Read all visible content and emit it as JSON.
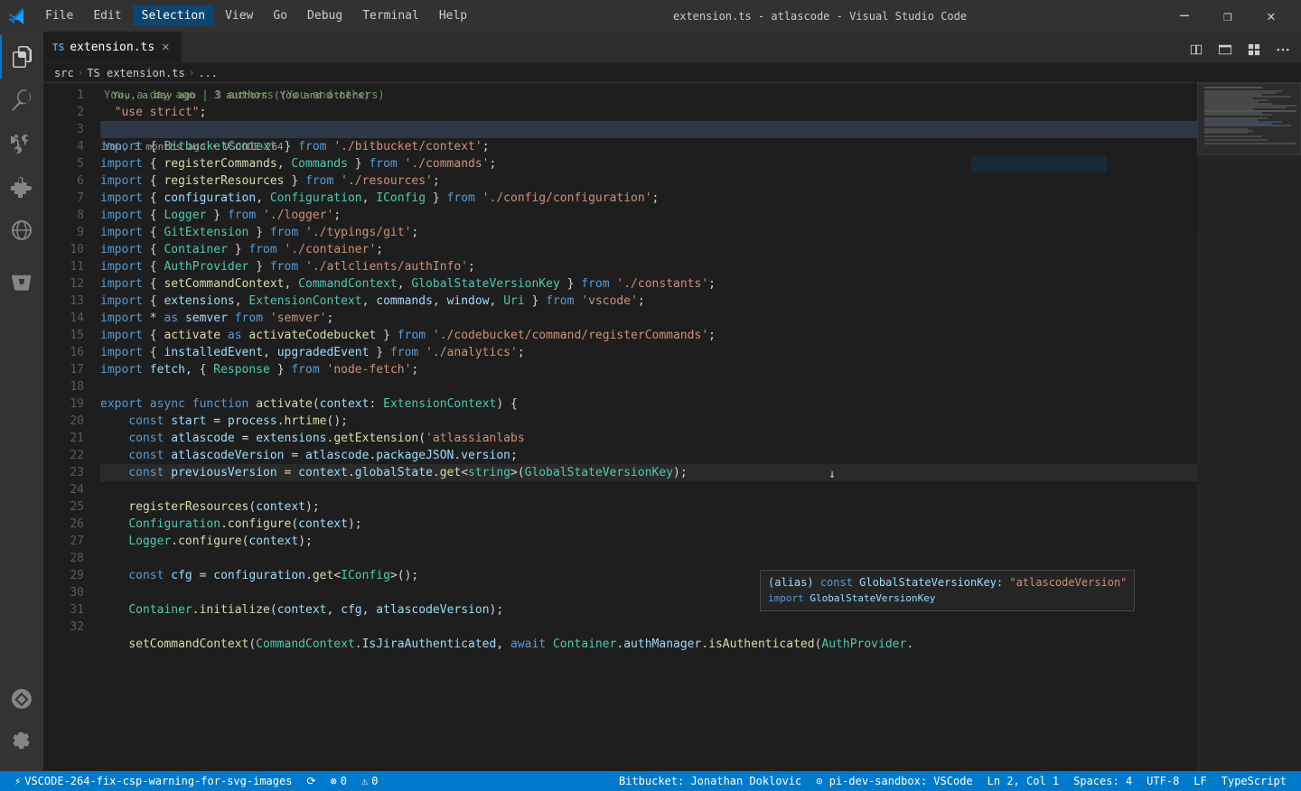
{
  "titleBar": {
    "logo": "VS",
    "menu": [
      "File",
      "Edit",
      "Selection",
      "View",
      "Go",
      "Debug",
      "Terminal",
      "Help"
    ],
    "activeMenu": "Selection",
    "title": "extension.ts - atlascode - Visual Studio Code",
    "buttons": [
      "─",
      "❐",
      "✕"
    ]
  },
  "tabs": [
    {
      "label": "extension.ts",
      "type": "ts",
      "active": true,
      "dirty": false
    }
  ],
  "breadcrumb": [
    "src",
    "TS extension.ts",
    "..."
  ],
  "blameTooltip": "You, a day ago | 3 authors (You and others)",
  "hoverPopup": {
    "line1_alias": "(alias) const GlobalStateVersionKey: \"atlascodeVersion\"",
    "line2_import": "import GlobalStateVersionKey"
  },
  "lines": [
    {
      "num": 1,
      "code": "  \"use strict\";"
    },
    {
      "num": 2,
      "code": ""
    },
    {
      "num": 3,
      "code": "import { BitbucketContext } from './bitbucket/context';"
    },
    {
      "num": 4,
      "code": "import { registerCommands, Commands } from './commands';"
    },
    {
      "num": 5,
      "code": "import { registerResources } from './resources';"
    },
    {
      "num": 6,
      "code": "import { configuration, Configuration, IConfig } from './config/configuration';"
    },
    {
      "num": 7,
      "code": "import { Logger } from './logger';"
    },
    {
      "num": 8,
      "code": "import { GitExtension } from './typings/git';"
    },
    {
      "num": 9,
      "code": "import { Container } from './container';"
    },
    {
      "num": 10,
      "code": "import { AuthProvider } from './atlclients/authInfo';"
    },
    {
      "num": 11,
      "code": "import { setCommandContext, CommandContext, GlobalStateVersionKey } from './constants';"
    },
    {
      "num": 12,
      "code": "import { extensions, ExtensionContext, commands, window, Uri } from 'vscode';"
    },
    {
      "num": 13,
      "code": "import * as semver from 'semver';"
    },
    {
      "num": 14,
      "code": "import { activate as activateCodebucket } from './codebucket/command/registerCommands';"
    },
    {
      "num": 15,
      "code": "import { installedEvent, upgradedEvent } from './analytics';"
    },
    {
      "num": 16,
      "code": "import fetch, { Response } from 'node-fetch';"
    },
    {
      "num": 17,
      "code": ""
    },
    {
      "num": 18,
      "code": "export async function activate(context: ExtensionContext) {"
    },
    {
      "num": 19,
      "code": "    const start = process.hrtime();"
    },
    {
      "num": 20,
      "code": "    const atlascode = extensions.getExtension('atlassianlabs"
    },
    {
      "num": 21,
      "code": "    const atlascodeVersion = atlascode.packageJSON.version;"
    },
    {
      "num": 22,
      "code": "    const previousVersion = context.globalState.get<string>(GlobalStateVersionKey);"
    },
    {
      "num": 23,
      "code": ""
    },
    {
      "num": 24,
      "code": "    registerResources(context);"
    },
    {
      "num": 25,
      "code": "    Configuration.configure(context);"
    },
    {
      "num": 26,
      "code": "    Logger.configure(context);"
    },
    {
      "num": 27,
      "code": ""
    },
    {
      "num": 28,
      "code": "    const cfg = configuration.get<IConfig>();"
    },
    {
      "num": 29,
      "code": ""
    },
    {
      "num": 30,
      "code": "    Container.initialize(context, cfg, atlascodeVersion);"
    },
    {
      "num": 31,
      "code": ""
    },
    {
      "num": 32,
      "code": "    setCommandContext(CommandContext.IsJiraAuthenticated, await Container.authManager.isAuthenticated(AuthProvider."
    }
  ],
  "statusBar": {
    "left": [
      {
        "icon": "⚡",
        "label": "VSCODE-264-fix-csp-warning-for-svg-images"
      },
      {
        "icon": "⟳",
        "label": ""
      },
      {
        "icon": "⊗",
        "label": "0"
      },
      {
        "icon": "⚠",
        "label": "0"
      }
    ],
    "right": [
      {
        "label": "Bitbucket: Jonathan Doklovic"
      },
      {
        "label": "⊙ pi-dev-sandbox: VSCode"
      },
      {
        "label": "Ln 2, Col 1"
      },
      {
        "label": "Spaces: 4"
      },
      {
        "label": "UTF-8"
      },
      {
        "label": "LF"
      },
      {
        "label": "TypeScript"
      }
    ]
  },
  "colors": {
    "titleBg": "#323233",
    "activityBg": "#333333",
    "editorBg": "#1e1e1e",
    "tabActiveBg": "#1e1e1e",
    "tabInactiveBg": "#2d2d2d",
    "statusBg": "#007acc",
    "accent": "#0078d4"
  }
}
